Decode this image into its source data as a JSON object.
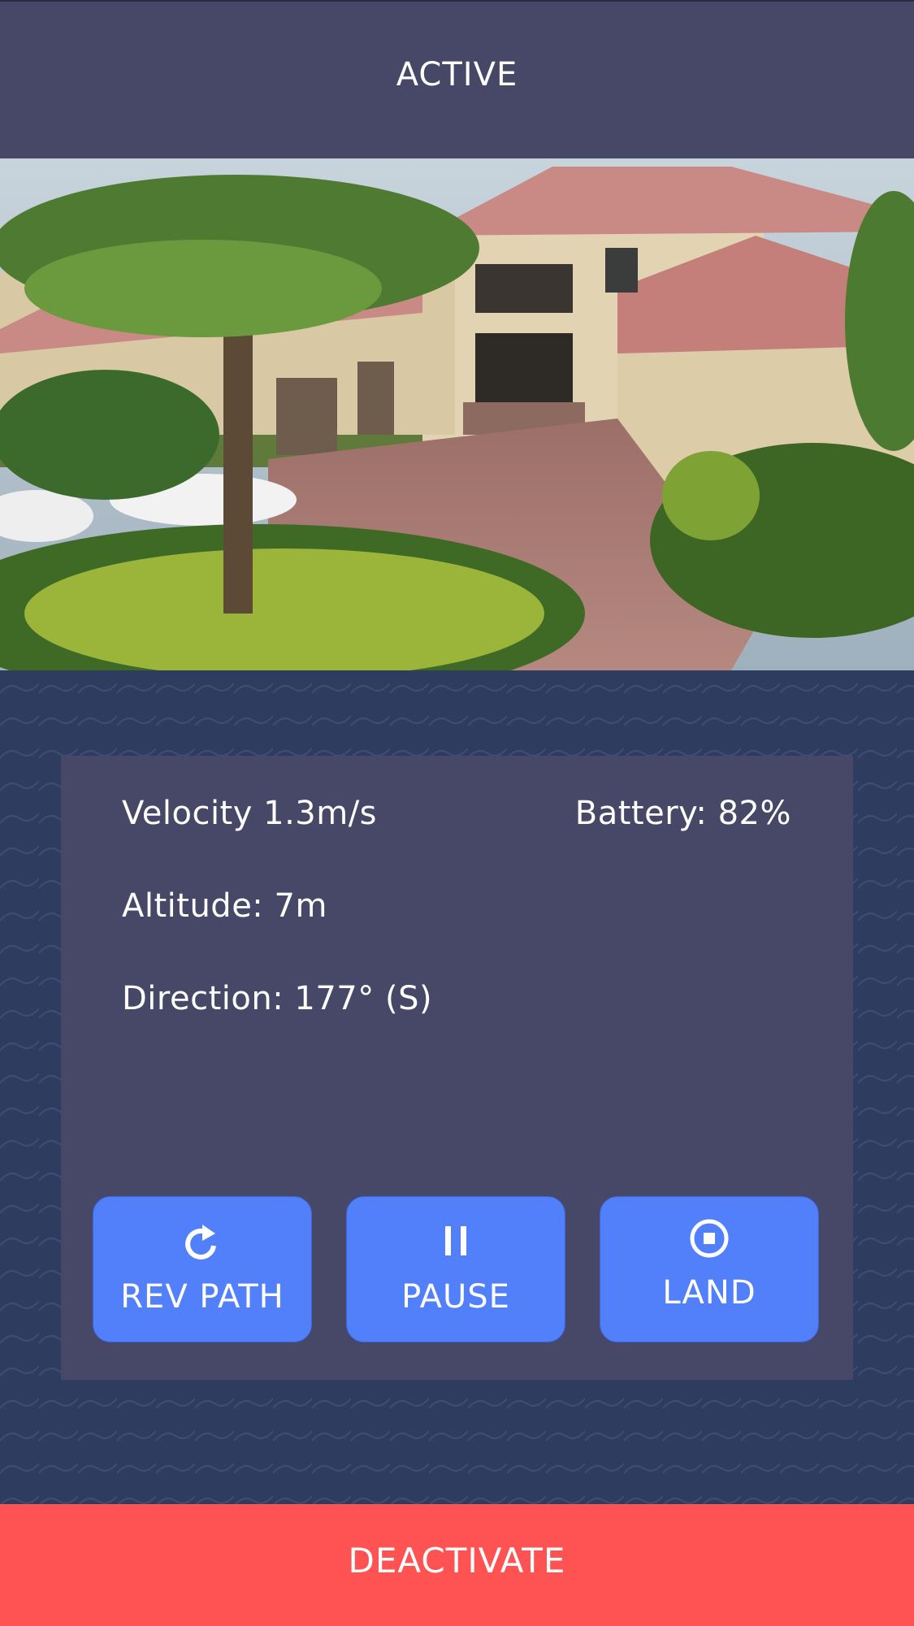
{
  "header": {
    "status_title": "ACTIVE"
  },
  "camera": {
    "description_icon": "camera-feed-image"
  },
  "telemetry": {
    "velocity": "Velocity 1.3m/s",
    "battery": "Battery: 82%",
    "altitude": "Altitude: 7m",
    "direction": "Direction: 177° (S)"
  },
  "controls": {
    "rev_path": {
      "label": "REV PATH",
      "icon": "refresh-icon"
    },
    "pause": {
      "label": "PAUSE",
      "icon": "pause-icon"
    },
    "land": {
      "label": "LAND",
      "icon": "land-target-icon"
    }
  },
  "footer": {
    "deactivate_label": "DEACTIVATE"
  },
  "colors": {
    "header_bg": "#474767",
    "panel_bg": "#474767",
    "background": "#2d3c5f",
    "button_blue": "#5280fa",
    "deactivate_red": "#ff5252",
    "text": "#ffffff"
  }
}
